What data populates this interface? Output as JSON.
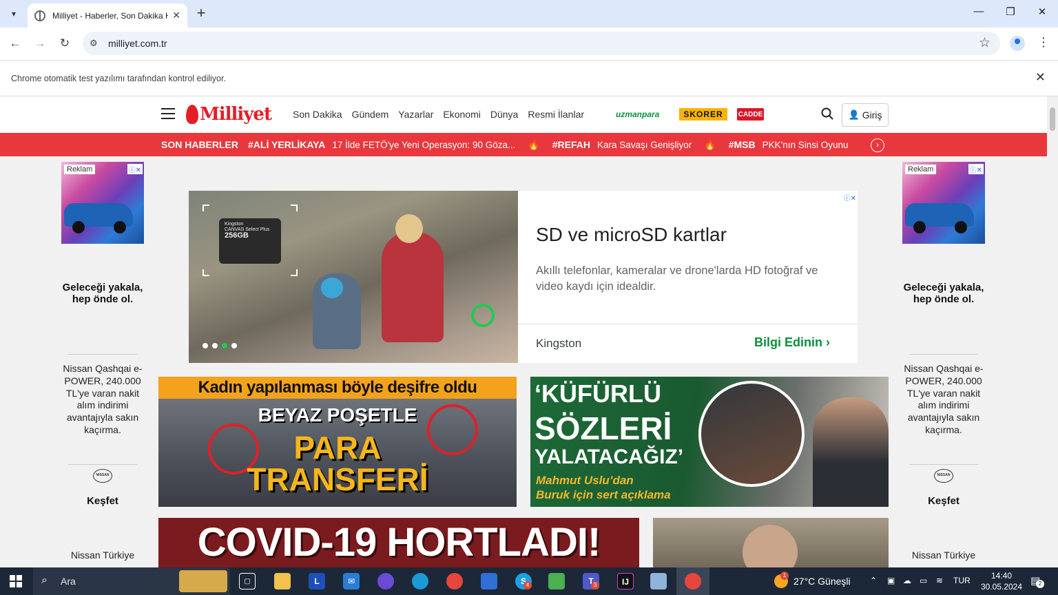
{
  "browser": {
    "tab_title": "Milliyet - Haberler, Son Dakika Haberleri",
    "url": "milliyet.com.tr",
    "infobar_message": "Chrome otomatik test yazılımı tarafından kontrol ediliyor."
  },
  "header": {
    "logo": "Milliyet",
    "nav": [
      "Son Dakika",
      "Gündem",
      "Yazarlar",
      "Ekonomi",
      "Dünya",
      "Resmi İlanlar"
    ],
    "partners": [
      "uzmanpara",
      "SKORER",
      "CADDE"
    ],
    "login_label": "Giriş"
  },
  "ticker": {
    "label": "SON HABERLER",
    "items": [
      {
        "tag": "#ALİ YERLİKAYA",
        "text": "17 İlde FETÖ'ye Yeni Operasyon: 90 Göza..."
      },
      {
        "tag": "#REFAH",
        "text": "Kara Savaşı Genişliyor"
      },
      {
        "tag": "#MSB",
        "text": "PKK'nın Sinsi Oyunu"
      }
    ]
  },
  "side_ad": {
    "badge": "Reklam",
    "headline": "Geleceği yakala, hep önde ol.",
    "description": "Nissan Qashqai e-POWER, 240.000 TL'ye varan nakit alım indirimi avantajıyla sakın kaçırma.",
    "logo_text": "NISSAN",
    "cta": "Keşfet",
    "advertiser": "Nissan Türkiye"
  },
  "banner_ad": {
    "card_brand": "Kingston",
    "card_text": "CANVAS Select Plus",
    "card_capacity": "256GB",
    "headline": "SD ve microSD kartlar",
    "body": "Akıllı telefonlar, kameralar ve drone'larda HD fotoğraf ve video kaydı için idealdir.",
    "brand": "Kingston",
    "cta": "Bilgi Edinin"
  },
  "news": {
    "card1": {
      "top": "Kadın yapılanması böyle deşifre oldu",
      "line1": "BEYAZ POŞETLE",
      "line2a": "PARA",
      "line2b": "TRANSFERİ"
    },
    "card2": {
      "l1": "‘KÜFÜRLÜ",
      "l2": "SÖZLERİ",
      "l3": "YALATACAĞIZ’",
      "l4a": "Mahmut Uslu’dan",
      "l4b": "Buruk için sert açıklama"
    },
    "card3": {
      "title": "COVID-19 HORTLADI!"
    }
  },
  "taskbar": {
    "search_placeholder": "Ara",
    "weather": "27°C  Güneşli",
    "lang": "TUR",
    "time": "14:40",
    "date": "30.05.2024",
    "notifications": "2",
    "badges": {
      "skype": "4",
      "teams": "3",
      "weather": "1"
    }
  }
}
